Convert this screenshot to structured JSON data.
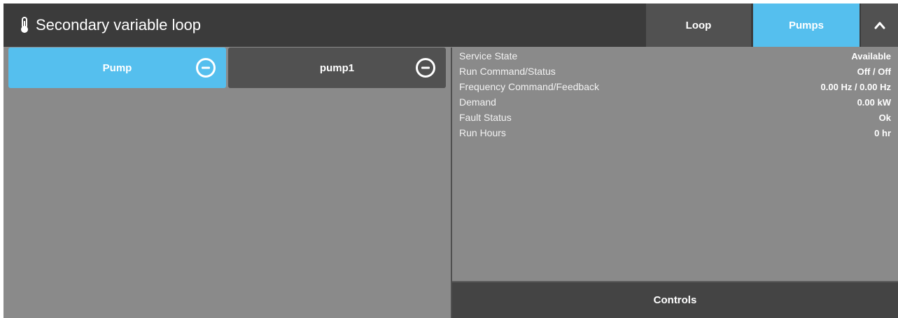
{
  "header": {
    "title": "Secondary variable loop",
    "title_icon": "thermometer-icon",
    "loop_button": "Loop",
    "pumps_button": "Pumps",
    "collapse_icon": "chevron-up-icon"
  },
  "tabs": [
    {
      "label": "Pump",
      "icon": "minus-circle-icon",
      "active": true
    },
    {
      "label": "pump1",
      "icon": "minus-circle-icon",
      "active": false
    }
  ],
  "details": [
    {
      "label": "Service State",
      "value": "Available"
    },
    {
      "label": "Run Command/Status",
      "value": "Off / Off"
    },
    {
      "label": "Frequency Command/Feedback",
      "value": "0.00 Hz / 0.00 Hz"
    },
    {
      "label": "Demand",
      "value": "0.00 kW"
    },
    {
      "label": "Fault Status",
      "value": "Ok"
    },
    {
      "label": "Run Hours",
      "value": "0 hr"
    }
  ],
  "controls_button": "Controls",
  "colors": {
    "accent": "#55bfee",
    "header_bg": "#3b3b3b",
    "panel_bg": "#8a8a8a",
    "button_bg": "#515151"
  }
}
